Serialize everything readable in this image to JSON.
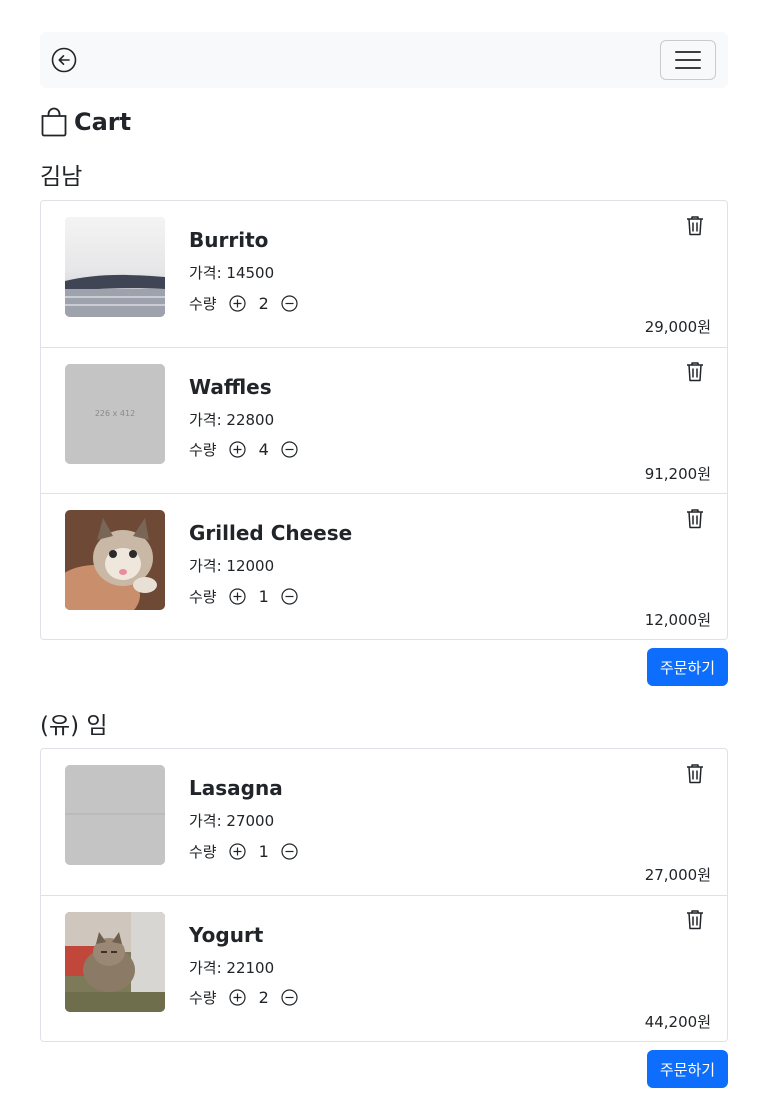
{
  "nav": {
    "back_icon": "arrow-left-circle-icon",
    "menu_icon": "hamburger-icon"
  },
  "page": {
    "title": "Cart",
    "title_icon": "shopping-bag-icon"
  },
  "labels": {
    "price_prefix": "가격: ",
    "qty_label": "수량",
    "currency_suffix": "원"
  },
  "stores": [
    {
      "name": "김남",
      "order_label": "주문하기",
      "items": [
        {
          "name": "Burrito",
          "price_text": "가격: 14500",
          "qty": "2",
          "subtotal": "29,000원",
          "thumb": "landscape"
        },
        {
          "name": "Waffles",
          "price_text": "가격: 22800",
          "qty": "4",
          "subtotal": "91,200원",
          "thumb": "placeholder",
          "placeholder_text": "226 x 412"
        },
        {
          "name": "Grilled Cheese",
          "price_text": "가격: 12000",
          "qty": "1",
          "subtotal": "12,000원",
          "thumb": "kitten"
        }
      ]
    },
    {
      "name": "(유) 임",
      "order_label": "주문하기",
      "items": [
        {
          "name": "Lasagna",
          "price_text": "가격: 27000",
          "qty": "1",
          "subtotal": "27,000원",
          "thumb": "gray"
        },
        {
          "name": "Yogurt",
          "price_text": "가격: 22100",
          "qty": "2",
          "subtotal": "44,200원",
          "thumb": "cat-outdoor"
        }
      ]
    }
  ],
  "colors": {
    "primary": "#0d6efd",
    "navbar_bg": "#f8f9fa",
    "border": "#dee2e6"
  }
}
